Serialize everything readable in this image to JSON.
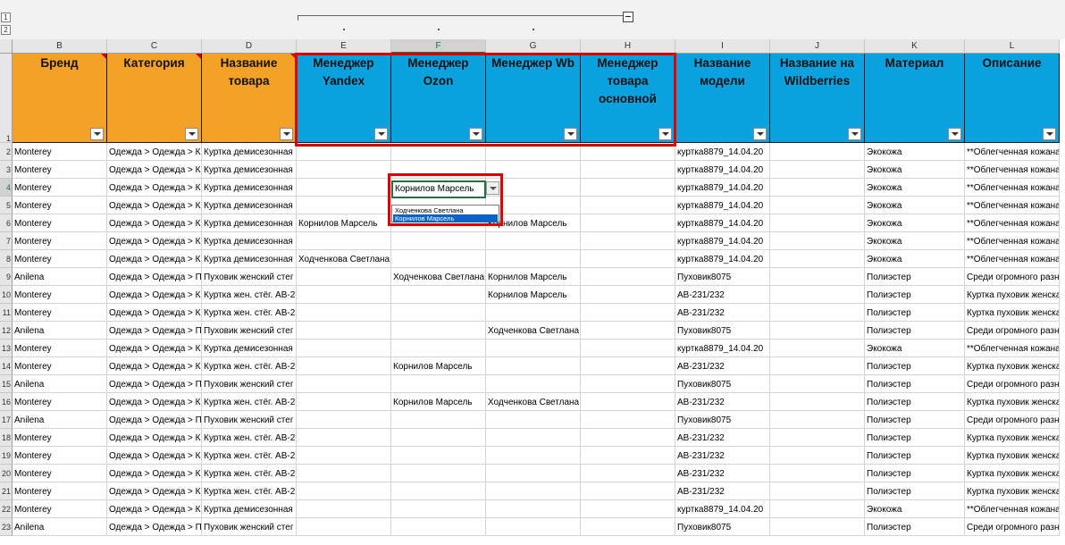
{
  "outline": {
    "levels": [
      "1",
      "2"
    ]
  },
  "columns": [
    "B",
    "C",
    "D",
    "E",
    "F",
    "G",
    "H",
    "I",
    "J",
    "K",
    "L"
  ],
  "selected_column": "F",
  "header_row_number": "1",
  "headers": [
    {
      "label": "Бренд",
      "color": "#f4a227",
      "comment": true
    },
    {
      "label": "Категория",
      "color": "#f4a227",
      "comment": true
    },
    {
      "label": "Название товара",
      "color": "#f4a227",
      "comment": true
    },
    {
      "label": "Менеджер Yandex",
      "color": "#0aa2de",
      "comment": false
    },
    {
      "label": "Менеджер Ozon",
      "color": "#0aa2de",
      "comment": false
    },
    {
      "label": "Менеджер Wb",
      "color": "#0aa2de",
      "comment": false
    },
    {
      "label": "Менеджер товара основной",
      "color": "#0aa2de",
      "comment": false
    },
    {
      "label": "Название модели",
      "color": "#0aa2de",
      "comment": false
    },
    {
      "label": "Название на Wildberries",
      "color": "#0aa2de",
      "comment": false
    },
    {
      "label": "Материал",
      "color": "#0aa2de",
      "comment": false
    },
    {
      "label": "Описание",
      "color": "#0aa2de",
      "comment": false
    }
  ],
  "rows": [
    {
      "num": "2",
      "cells": [
        "Monterey",
        "Одежда > Одежда > К",
        "Куртка демисезонная",
        "",
        "",
        "",
        "",
        "куртка8879_14.04.20",
        "",
        "Экокожа",
        "**Облегченная кожаная"
      ]
    },
    {
      "num": "3",
      "cells": [
        "Monterey",
        "Одежда > Одежда > К",
        "Куртка демисезонная",
        "",
        "",
        "",
        "",
        "куртка8879_14.04.20",
        "",
        "Экокожа",
        "**Облегченная кожаная"
      ]
    },
    {
      "num": "4",
      "cells": [
        "Monterey",
        "Одежда > Одежда > К",
        "Куртка демисезонная",
        "",
        "",
        "",
        "",
        "куртка8879_14.04.20",
        "",
        "Экокожа",
        "**Облегченная кожаная"
      ]
    },
    {
      "num": "5",
      "cells": [
        "Monterey",
        "Одежда > Одежда > К",
        "Куртка демисезонная",
        "",
        "",
        "",
        "",
        "куртка8879_14.04.20",
        "",
        "Экокожа",
        "**Облегченная кожаная"
      ]
    },
    {
      "num": "6",
      "cells": [
        "Monterey",
        "Одежда > Одежда > К",
        "Куртка демисезонная",
        "Корнилов Марсель",
        "",
        "Корнилов Марсель",
        "",
        "куртка8879_14.04.20",
        "",
        "Экокожа",
        "**Облегченная кожаная"
      ]
    },
    {
      "num": "7",
      "cells": [
        "Monterey",
        "Одежда > Одежда > К",
        "Куртка демисезонная",
        "",
        "",
        "",
        "",
        "куртка8879_14.04.20",
        "",
        "Экокожа",
        "**Облегченная кожаная"
      ]
    },
    {
      "num": "8",
      "cells": [
        "Monterey",
        "Одежда > Одежда > К",
        "Куртка демисезонная",
        "Ходченкова  Светлана",
        "",
        "",
        "",
        "куртка8879_14.04.20",
        "",
        "Экокожа",
        "**Облегченная кожаная"
      ]
    },
    {
      "num": "9",
      "cells": [
        "Anilena",
        "Одежда > Одежда > П",
        "Пуховик женский стег",
        "",
        "Ходченкова  Светлана",
        "Корнилов Марсель",
        "",
        "Пуховик8075",
        "",
        "Полиэстер",
        "Среди огромного разноо"
      ]
    },
    {
      "num": "10",
      "cells": [
        "Monterey",
        "Одежда > Одежда > К",
        "Куртка жен. стёг. AB-2",
        "",
        "",
        "Корнилов Марсель",
        "",
        "AB-231/232",
        "",
        "Полиэстер",
        "Куртка пуховик женская"
      ]
    },
    {
      "num": "11",
      "cells": [
        "Monterey",
        "Одежда > Одежда > К",
        "Куртка жен. стёг. AB-2",
        "",
        "",
        "",
        "",
        "AB-231/232",
        "",
        "Полиэстер",
        "Куртка пуховик женская"
      ]
    },
    {
      "num": "12",
      "cells": [
        "Anilena",
        "Одежда > Одежда > П",
        "Пуховик женский стег",
        "",
        "",
        "Ходченкова  Светлана",
        "",
        "Пуховик8075",
        "",
        "Полиэстер",
        "Среди огромного разноо"
      ]
    },
    {
      "num": "13",
      "cells": [
        "Monterey",
        "Одежда > Одежда > К",
        "Куртка демисезонная",
        "",
        "",
        "",
        "",
        "куртка8879_14.04.20",
        "",
        "Экокожа",
        "**Облегченная кожаная"
      ]
    },
    {
      "num": "14",
      "cells": [
        "Monterey",
        "Одежда > Одежда > К",
        "Куртка жен. стёг. AB-2",
        "",
        "Корнилов Марсель",
        "",
        "",
        "AB-231/232",
        "",
        "Полиэстер",
        "Куртка пуховик женская"
      ]
    },
    {
      "num": "15",
      "cells": [
        "Anilena",
        "Одежда > Одежда > П",
        "Пуховик женский стег",
        "",
        "",
        "",
        "",
        "Пуховик8075",
        "",
        "Полиэстер",
        "Среди огромного разноо"
      ]
    },
    {
      "num": "16",
      "cells": [
        "Monterey",
        "Одежда > Одежда > К",
        "Куртка жен. стёг. AB-2",
        "",
        "Корнилов Марсель",
        "Ходченкова  Светлана",
        "",
        "AB-231/232",
        "",
        "Полиэстер",
        "Куртка пуховик женская"
      ]
    },
    {
      "num": "17",
      "cells": [
        "Anilena",
        "Одежда > Одежда > П",
        "Пуховик женский стег",
        "",
        "",
        "",
        "",
        "Пуховик8075",
        "",
        "Полиэстер",
        "Среди огромного разноо"
      ]
    },
    {
      "num": "18",
      "cells": [
        "Monterey",
        "Одежда > Одежда > К",
        "Куртка жен. стёг. AB-2",
        "",
        "",
        "",
        "",
        "AB-231/232",
        "",
        "Полиэстер",
        "Куртка пуховик женская"
      ]
    },
    {
      "num": "19",
      "cells": [
        "Monterey",
        "Одежда > Одежда > К",
        "Куртка жен. стёг. AB-2",
        "",
        "",
        "",
        "",
        "AB-231/232",
        "",
        "Полиэстер",
        "Куртка пуховик женская"
      ]
    },
    {
      "num": "20",
      "cells": [
        "Monterey",
        "Одежда > Одежда > К",
        "Куртка жен. стёг. AB-2",
        "",
        "",
        "",
        "",
        "AB-231/232",
        "",
        "Полиэстер",
        "Куртка пуховик женская"
      ]
    },
    {
      "num": "21",
      "cells": [
        "Monterey",
        "Одежда > Одежда > К",
        "Куртка жен. стёг. AB-2",
        "",
        "",
        "",
        "",
        "AB-231/232",
        "",
        "Полиэстер",
        "Куртка пуховик женская"
      ]
    },
    {
      "num": "22",
      "cells": [
        "Monterey",
        "Одежда > Одежда > К",
        "Куртка демисезонная",
        "",
        "",
        "",
        "",
        "куртка8879_14.04.20",
        "",
        "Экокожа",
        "**Облегченная кожаная"
      ]
    },
    {
      "num": "23",
      "cells": [
        "Anilena",
        "Одежда > Одежда > П",
        "Пуховик женский стег",
        "",
        "",
        "",
        "",
        "Пуховик8075",
        "",
        "Полиэстер",
        "Среди огромного разноо"
      ]
    }
  ],
  "dropdown": {
    "row": "4",
    "column": "F",
    "current_value": "Корнилов Марсель",
    "options": [
      "Ходченкова  Светлана",
      "Корнилов Марсель"
    ],
    "highlighted_index": 1
  },
  "colors": {
    "orange_header": "#f4a227",
    "blue_header": "#0aa2de",
    "highlight_box": "#e00000",
    "active_cell_border": "#217346",
    "selected_option": "#0a63c9"
  }
}
